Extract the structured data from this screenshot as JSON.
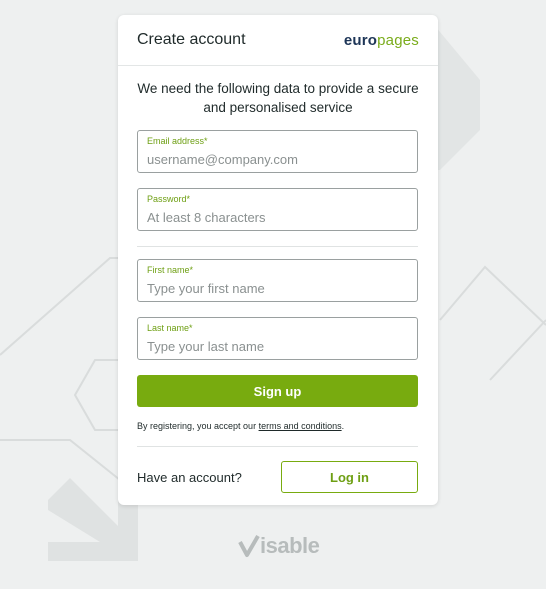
{
  "header": {
    "title": "Create account",
    "brand_part1": "euro",
    "brand_part2": "pages"
  },
  "intro_text": "We need the following data to provide a secure and personalised service",
  "fields": {
    "email": {
      "label": "Email address*",
      "placeholder": "username@company.com"
    },
    "password": {
      "label": "Password*",
      "placeholder": "At least 8 characters"
    },
    "first_name": {
      "label": "First name*",
      "placeholder": "Type your first name"
    },
    "last_name": {
      "label": "Last name*",
      "placeholder": "Type your last name"
    }
  },
  "signup_label": "Sign up",
  "terms": {
    "prefix": "By registering, you accept our ",
    "link": "terms and conditions",
    "suffix": "."
  },
  "footer": {
    "have_account": "Have an account?",
    "login_label": "Log in"
  },
  "footer_logo": "isable",
  "colors": {
    "accent": "#78ab0f",
    "brand_dark": "#1d3557",
    "background": "#eef0f0"
  }
}
